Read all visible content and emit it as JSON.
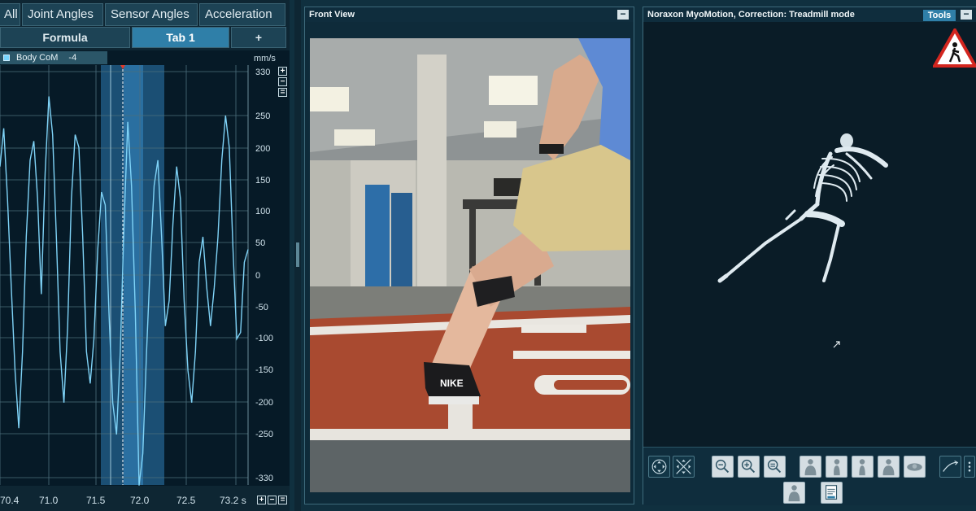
{
  "left_panel": {
    "tabs": [
      "All",
      "Joint Angles",
      "Sensor Angles",
      "Acceleration"
    ],
    "subtabs": [
      "Formula",
      "Tab 1",
      "+"
    ],
    "active_subtab": "Tab 1",
    "legend_label": "Body CoM",
    "legend_value": "-4",
    "unit": "mm/s",
    "y_ticks": [
      "330",
      "250",
      "200",
      "150",
      "100",
      "50",
      "0",
      "-50",
      "-100",
      "-150",
      "-200",
      "-250",
      "-330"
    ],
    "x_ticks": [
      "70.4",
      "71.0",
      "71.5",
      "72.0",
      "72.5",
      "73.2 s"
    ],
    "plus_label": "+",
    "minus_label": "−",
    "equals_label": "="
  },
  "middle_panel": {
    "title": "Front View",
    "minimize_label": "−",
    "shoe_brand": "NIKE"
  },
  "right_panel": {
    "title": "Noraxon MyoMotion, Correction: Treadmill mode",
    "tools_label": "Tools",
    "minimize_label": "−"
  },
  "colors": {
    "signal": "#7fd3f7",
    "selection": "#1c5a83",
    "accent": "#2f7fa8"
  }
}
